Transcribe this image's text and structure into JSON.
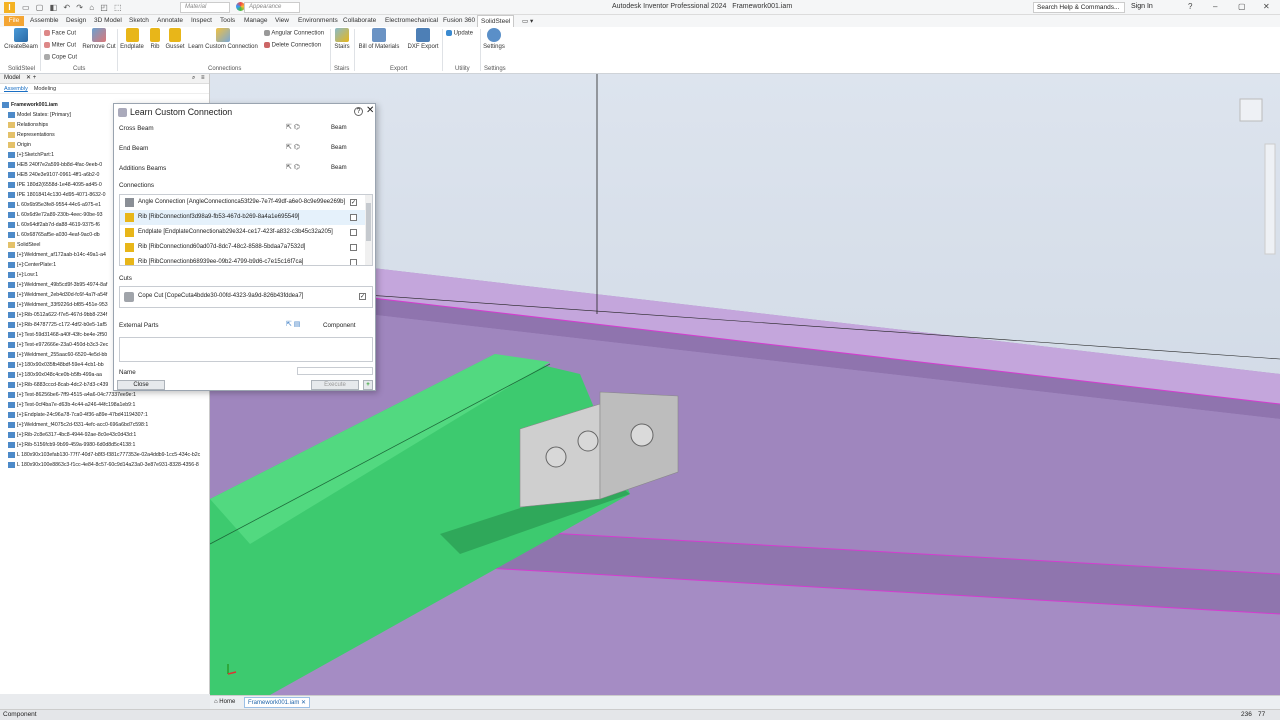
{
  "titlebar": {
    "file_tab": "File",
    "material": "Material",
    "appearance": "Appearance",
    "app_title": "Autodesk Inventor Professional 2024",
    "doc_title": "Framework001.iam",
    "search": "Search Help & Commands...",
    "signin": "Sign In"
  },
  "tabs": [
    "Assemble",
    "Design",
    "3D Model",
    "Sketch",
    "Annotate",
    "Inspect",
    "Tools",
    "Manage",
    "View",
    "Environments",
    "Collaborate",
    "Electromechanical",
    "Fusion 360",
    "SolidSteel"
  ],
  "ribbon": {
    "create_beam": "CreateBeam",
    "face_cut": "Face Cut",
    "miter_cut": "Miter Cut",
    "cope_cut": "Cope Cut",
    "remove_cut": "Remove Cut",
    "endplate": "Endplate",
    "rib": "Rib",
    "gusset": "Gusset",
    "learn_custom": "Learn Custom Connection",
    "angular": "Angular Connection",
    "delete_conn": "Delete Connection",
    "stairs": "Stairs",
    "bom": "Bill of Materials",
    "dxf": "DXF Export",
    "update": "Update",
    "settings": "Settings",
    "groups": {
      "solidsteel": "SolidSteel",
      "cuts": "Cuts",
      "connections": "Connections",
      "stairs": "Stairs",
      "export": "Export",
      "utility": "Utility",
      "settings": "Settings"
    }
  },
  "browser": {
    "title": "Model",
    "tab_assembly": "Assembly",
    "tab_modeling": "Modeling",
    "tree": [
      "Framework001.iam",
      "Model States: [Primary]",
      "Relationships",
      "Representations",
      "Origin",
      "[+]:SketchPart:1",
      "HEB 240f7e2a599-bb8d-4fac-9eeb-0",
      "HEB 240e3e9107-0961-4ff1-a6b2-0",
      "IPE 180d2(6558d-1e48-4095-ad45-0",
      "IPE 18018414c130-4d95-4071-8632-0",
      "L 60x6b95e3fe8-9554-44c6-a975-e1",
      "L 60x6d9e72a89-230b-4eec-90be-93",
      "L 60x64df2ab7d-da88-4619-9375-f6",
      "L 60x68765af5e-a030-4eaf-9ac0-db",
      "SolidSteel",
      "[+]:Weldment_af172aab-b14c-49a1-a4",
      "[+]:CenterPlate:1",
      "[+]:Low:1",
      "[+]:Weldment_49b5cd9f-3b95-4974-8af",
      "[+]:Weldment_2eb4d30d-fc6f-4a7f-a54f",
      "[+]:Weldment_33f9226d-bf85-451e-953",
      "[+]:Rib-0512a622-f7e5-467d-9bb8-234f",
      "[+]:Rib-84787725-c172-4df2-b0e5-1af5",
      "[+]:Test-59d31468-a40f-43fc-be4e-2f50",
      "[+]:Test-e972666e-23a0-450d-b3c3-2ec",
      "[+]:Weldment_255aac60-6520-4e5d-bb",
      "[+]:180x90x035fb48bdf-59e4-4cb1-bb",
      "[+]:180x90x048c4ce0b-b5fb-499a-aa",
      "[+]:Rib-6883cccd-8cab-4dc2-b7d3-c439",
      "[+]:Test-86256be6-7ff9-4515-a4a6-04c77337ee9e:1",
      "[+]:Test-0cf4ba7e-d63b-4c44-a246-44fc198a1eb9:1",
      "[+]:Endplate-24c96a78-7ca0-4f36-a89e-47bd41194307:1",
      "[+]:Weldment_f4075c2d-f331-4efc-acc0-696a6bd7c598:1",
      "[+]:Rib-2c8e6317-4bc8-4944-92ae-8c0e43c0d43d:1",
      "[+]:Rib-5156fcb9-9b99-459a-9980-6d0d8d5c4138:1",
      "L 180x90x103efab130-77f7-40d7-b8f3-f381c777353e-02a4ddb9-1cc5-434c-b2c",
      "L 180x90x100e8863c3-f1cc-4e84-8c57-60c9d14a23a0-3e87e931-8328-4356-8"
    ]
  },
  "dialog": {
    "title": "Learn Custom Connection",
    "cross_beam": "Cross Beam",
    "end_beam": "End Beam",
    "additions": "Additions Beams",
    "beam": "Beam",
    "connections_label": "Connections",
    "connections": [
      {
        "label": "Angle Connection [AngleConnectionca53f29e-7e7f-49df-a6e0-8c9e99ee269b]",
        "checked": true,
        "color": "#8a8f96"
      },
      {
        "label": "Rib [RibConnectionf3d98a9-fb53-467d-b269-8a4a1e695549]",
        "checked": false,
        "color": "#e8b619"
      },
      {
        "label": "Endplate [EndplateConnectionab29e324-ce17-423f-a832-c3b45c32a205]",
        "checked": false,
        "color": "#e8b619"
      },
      {
        "label": "Rib [RibConnectiond60ad07d-8dc7-48c2-8588-5bdaa7a7532d]",
        "checked": false,
        "color": "#e8b619"
      },
      {
        "label": "Rib [RibConnectionb68939ee-09b2-4799-b9d6-c7e15c16f7ca]",
        "checked": false,
        "color": "#e8b619"
      }
    ],
    "cuts_label": "Cuts",
    "cut_item": "Cope Cut [CopeCuta4bdde30-00fd-4323-9a9d-826b43fddea7]",
    "cut_checked": true,
    "external_label": "External Parts",
    "component": "Component",
    "name_label": "Name",
    "close": "Close",
    "execute": "Execute",
    "add": "+"
  },
  "bottom": {
    "home": "Home",
    "doc": "Framework001.iam"
  },
  "status": {
    "text": "Component",
    "page": "236",
    "zoom": "77"
  }
}
